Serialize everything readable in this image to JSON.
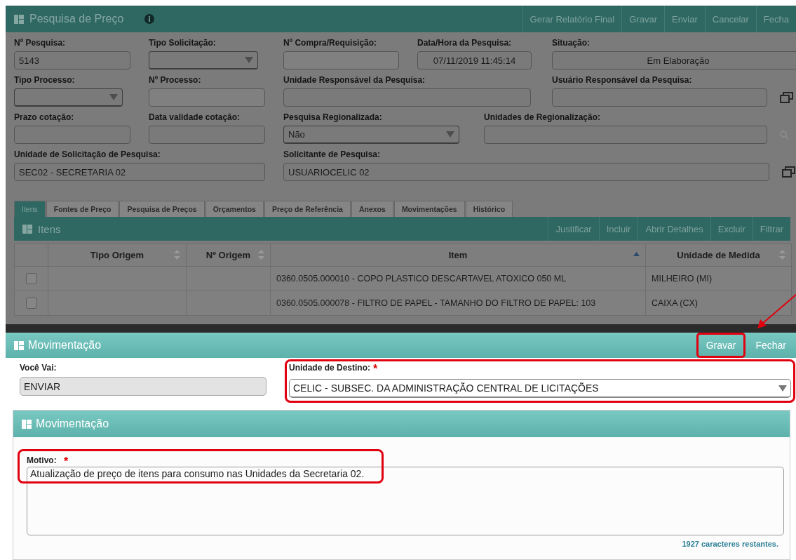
{
  "main_panel": {
    "title": "Pesquisa de Preço",
    "actions": [
      "Gerar Relatório Final",
      "Gravar",
      "Enviar",
      "Cancelar",
      "Fecha"
    ]
  },
  "form_rows": [
    [
      {
        "label": "Nº Pesquisa:",
        "kind": "readonly",
        "value": "5143"
      },
      {
        "label": "Tipo Solicitação:",
        "kind": "select"
      },
      {
        "label": "Nº Compra/Requisição:",
        "kind": "text"
      },
      {
        "label": "Data/Hora da Pesquisa:",
        "kind": "readonly",
        "value": "07/11/2019 11:45:14",
        "centered": true
      },
      {
        "label": "Situação:",
        "kind": "readonly",
        "value": "Em Elaboração",
        "centered": true
      }
    ],
    [
      {
        "label": "Tipo Processo:",
        "kind": "select"
      },
      {
        "label": "Nº Processo:",
        "kind": "text"
      },
      {
        "label": "Unidade Responsável da Pesquisa:",
        "kind": "readonly"
      },
      {
        "label": "Usuário Responsável da Pesquisa:",
        "kind": "readonly",
        "popup_button": true
      }
    ],
    [
      {
        "label": "Prazo cotação:",
        "kind": "readonly"
      },
      {
        "label": "Data validade cotação:",
        "kind": "readonly"
      },
      {
        "label": "Pesquisa Regionalizada:",
        "kind": "select",
        "value": "Não"
      },
      {
        "label": "Unidades de Regionalização:",
        "kind": "readonly",
        "search_button": true
      }
    ],
    [
      {
        "label": "Unidade de Solicitação de Pesquisa:",
        "kind": "readonly",
        "value": "SEC02 - SECRETARIA 02"
      },
      {
        "label": "Solicitante de Pesquisa:",
        "kind": "readonly",
        "value": "USUARIOCELIC 02",
        "popup_button": true
      }
    ]
  ],
  "tabs": [
    {
      "label": "Itens",
      "selected": true
    },
    {
      "label": "Fontes de Preço",
      "selected": false
    },
    {
      "label": "Pesquisa de Preços",
      "selected": false
    },
    {
      "label": "Orçamentos",
      "selected": false
    },
    {
      "label": "Preço de Referência",
      "selected": false
    },
    {
      "label": "Anexos",
      "selected": false
    },
    {
      "label": "Movimentações",
      "selected": false
    },
    {
      "label": "Histórico",
      "selected": false
    }
  ],
  "items_panel": {
    "title": "Itens",
    "actions": [
      "Justificar",
      "Incluir",
      "Abrir Detalhes",
      "Excluir",
      "Filtrar"
    ]
  },
  "table": {
    "columns": [
      {
        "label": "Tipo Origem",
        "sorted": false
      },
      {
        "label": "Nº Origem",
        "sorted": false
      },
      {
        "label": "Item",
        "sorted": true
      },
      {
        "label": "Unidade de Medida",
        "sorted": false
      }
    ],
    "rows": [
      {
        "checked": false,
        "item": "0360.0505.000010 - COPO PLASTICO DESCARTAVEL ATOXICO 050 ML",
        "unit": "MILHEIRO (MI)"
      },
      {
        "checked": false,
        "item": "0360.0505.000078 - FILTRO DE PAPEL - TAMANHO DO FILTRO DE PAPEL: 103",
        "unit": "CAIXA (CX)"
      }
    ]
  },
  "modal": {
    "title": "Movimentação",
    "buttons": [
      {
        "label": "Gravar",
        "highlighted": true
      },
      {
        "label": "Fechar",
        "highlighted": false
      }
    ],
    "fields": [
      {
        "label": "Você Vai:",
        "kind": "readonly",
        "value": "ENVIAR",
        "highlighted": false
      },
      {
        "label": "Unidade de Destino:",
        "kind": "select",
        "value": "CELIC - SUBSEC. DA ADMINISTRAÇÃO CENTRAL DE LICITAÇÕES",
        "required_mark": "*",
        "highlighted": true
      }
    ],
    "section": {
      "title": "Movimentação",
      "field": {
        "label": "Motivo:",
        "required_mark": "*",
        "highlighted": true,
        "value": "Atualização de preço de itens para consumo nas Unidades da Secretaria 02."
      },
      "counter": "1927 caracteres restantes."
    }
  }
}
